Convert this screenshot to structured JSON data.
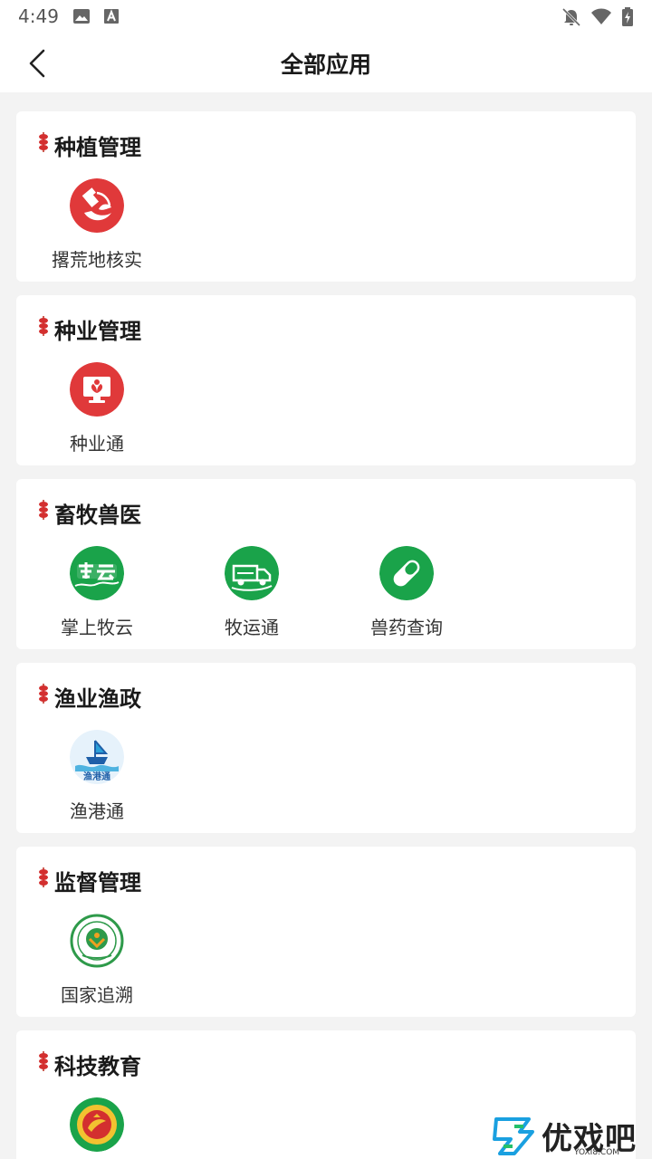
{
  "status_bar": {
    "time": "4:49",
    "icons": [
      "image-icon",
      "text-a-icon",
      "notifications-off-icon",
      "wifi-icon",
      "battery-charging-icon"
    ]
  },
  "header": {
    "title": "全部应用",
    "back_icon": "chevron-left-icon"
  },
  "sections": [
    {
      "title": "种植管理",
      "apps": [
        {
          "label": "撂荒地核实",
          "icon": "satellite-leaf-icon",
          "color": "#e0393a"
        }
      ]
    },
    {
      "title": "种业管理",
      "apps": [
        {
          "label": "种业通",
          "icon": "monitor-sprout-icon",
          "color": "#e0393a"
        }
      ]
    },
    {
      "title": "畜牧兽医",
      "apps": [
        {
          "label": "掌上牧云",
          "icon": "muyun-logo-icon",
          "color": "#1aa34a"
        },
        {
          "label": "牧运通",
          "icon": "livestock-truck-icon",
          "color": "#1aa34a"
        },
        {
          "label": "兽药查询",
          "icon": "capsule-pill-icon",
          "color": "#1aa34a"
        }
      ]
    },
    {
      "title": "渔业渔政",
      "apps": [
        {
          "label": "渔港通",
          "icon": "fishing-port-ship-icon",
          "color": "#2a6fb4"
        }
      ]
    },
    {
      "title": "监督管理",
      "apps": [
        {
          "label": "国家追溯",
          "icon": "traceability-seal-icon",
          "color": "#2e9a4a"
        }
      ]
    },
    {
      "title": "科技教育",
      "apps": [
        {
          "label": "",
          "icon": "education-seal-icon",
          "color": "#1aa34a"
        }
      ]
    }
  ],
  "watermark": {
    "text": "优戏吧",
    "sub": "YOXI8.COM",
    "icon": "yx-logo-icon"
  },
  "colors": {
    "accent_red": "#e0393a",
    "accent_green": "#1aa34a",
    "background": "#f3f3f3"
  }
}
